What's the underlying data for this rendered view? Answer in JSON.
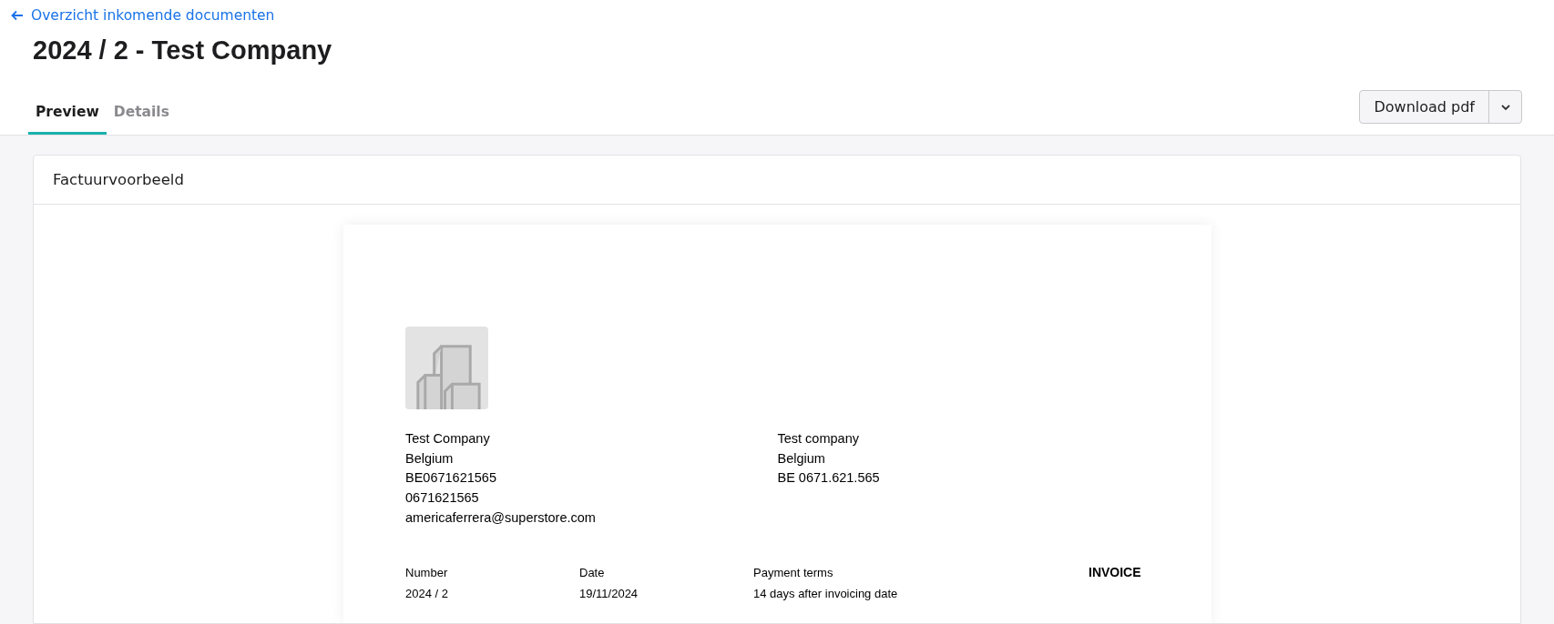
{
  "back_link": {
    "label": "Overzicht inkomende documenten"
  },
  "title": "2024 / 2 - Test Company",
  "tabs": [
    {
      "label": "Preview",
      "selected": true
    },
    {
      "label": "Details",
      "selected": false
    }
  ],
  "actions": {
    "download": "Download pdf"
  },
  "card": {
    "title": "Factuurvoorbeeld"
  },
  "invoice": {
    "sender": [
      "Test Company",
      "Belgium",
      "BE0671621565",
      "0671621565",
      "americaferrera@superstore.com"
    ],
    "recipient": [
      "Test company",
      "Belgium",
      "BE 0671.621.565"
    ],
    "meta": [
      {
        "label": "Number",
        "value": "2024 / 2"
      },
      {
        "label": "Date",
        "value": "19/11/2024"
      },
      {
        "label": "Payment terms",
        "value": "14 days after invoicing date"
      }
    ],
    "doc_type": "INVOICE"
  }
}
